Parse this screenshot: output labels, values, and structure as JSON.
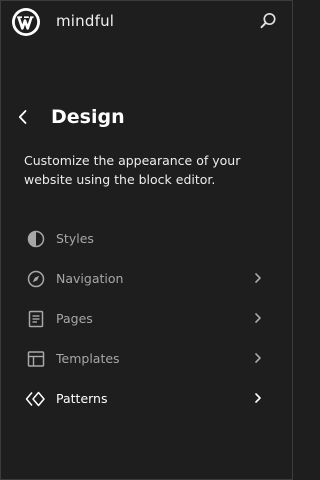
{
  "header": {
    "site_title": "mindful",
    "logo_icon": "wordpress-logo-icon",
    "search_icon": "search-icon"
  },
  "main": {
    "title": "Design",
    "description": "Customize the appearance of your website using the block editor.",
    "back_icon": "chevron-left-icon"
  },
  "nav": {
    "items": [
      {
        "label": "Styles",
        "icon": "half-circle-icon",
        "has_chevron": false,
        "active": false
      },
      {
        "label": "Navigation",
        "icon": "compass-icon",
        "has_chevron": true,
        "active": false
      },
      {
        "label": "Pages",
        "icon": "page-icon",
        "has_chevron": true,
        "active": false
      },
      {
        "label": "Templates",
        "icon": "layout-icon",
        "has_chevron": true,
        "active": false
      },
      {
        "label": "Patterns",
        "icon": "symbol-icon",
        "has_chevron": true,
        "active": true
      }
    ]
  },
  "colors": {
    "background": "#1e1e1e",
    "text_primary": "#ffffff",
    "text_muted": "#a7a7a7"
  }
}
